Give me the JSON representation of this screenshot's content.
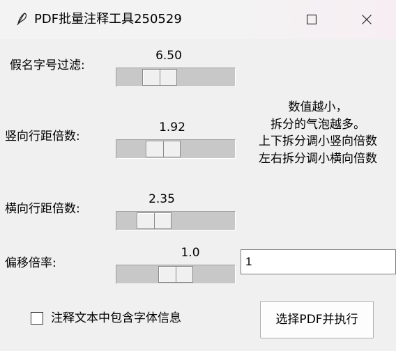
{
  "window": {
    "title": "PDF批量注释工具250529",
    "icons": [
      "feather-icon",
      "minimize-icon",
      "maximize-icon",
      "close-icon"
    ]
  },
  "sliders": [
    {
      "label": "假名字号过滤:",
      "value_text": "6.50",
      "position": 0.31
    },
    {
      "label": "竖向行距倍数:",
      "value_text": "1.92",
      "position": 0.35
    },
    {
      "label": "横向行距倍数:",
      "value_text": "2.35",
      "position": 0.24
    },
    {
      "label": "偏移倍率:",
      "value_text": "1.0",
      "position": 0.5
    }
  ],
  "info": {
    "lines": [
      "数值越小，",
      "拆分的气泡越多。",
      "上下拆分调小竖向倍数",
      "左右拆分调小横向倍数"
    ]
  },
  "offset_entry": {
    "value": "1"
  },
  "checkbox": {
    "label": "注释文本中包含字体信息",
    "checked": false
  },
  "run_button": {
    "label": "选择PDF并执行"
  },
  "colors": {
    "window_bg": "#f0f0f0",
    "trough": "#c8c8c8",
    "thumb": "#f0f0f0"
  }
}
